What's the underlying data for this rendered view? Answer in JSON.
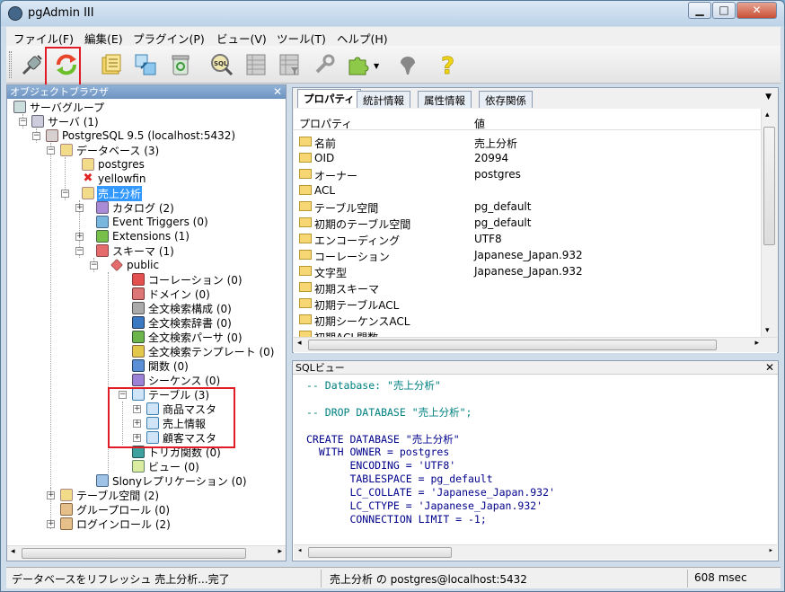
{
  "window": {
    "title": "pgAdmin III",
    "minimize": "▁",
    "maximize": "□",
    "close": "✕"
  },
  "menu": [
    "ファイル(F)",
    "編集(E)",
    "プラグイン(P)",
    "ビュー(V)",
    "ツール(T)",
    "ヘルプ(H)"
  ],
  "toolbar": {
    "buttons": [
      "connect-icon",
      "refresh-icon",
      "properties-icon",
      "create-icon",
      "delete-icon",
      "sql-query-icon",
      "view-data-icon",
      "filtered-view-icon",
      "maintenance-icon",
      "plugins-icon",
      "help-icon",
      "hint-icon"
    ]
  },
  "browser": {
    "title": "オブジェクトブラウザ",
    "close": "✕",
    "nodes": [
      {
        "label": "サーバグループ"
      },
      {
        "label": "サーバ (1)"
      },
      {
        "label": "PostgreSQL 9.5 (localhost:5432)"
      },
      {
        "label": "データベース (3)"
      },
      {
        "label": "postgres"
      },
      {
        "label": "yellowfin"
      },
      {
        "label": "売上分析"
      },
      {
        "label": "カタログ (2)"
      },
      {
        "label": "Event Triggers (0)"
      },
      {
        "label": "Extensions (1)"
      },
      {
        "label": "スキーマ (1)"
      },
      {
        "label": "public"
      },
      {
        "label": "コーレーション (0)"
      },
      {
        "label": "ドメイン (0)"
      },
      {
        "label": "全文検索構成 (0)"
      },
      {
        "label": "全文検索辞書 (0)"
      },
      {
        "label": "全文検索パーサ (0)"
      },
      {
        "label": "全文検索テンプレート (0)"
      },
      {
        "label": "関数 (0)"
      },
      {
        "label": "シーケンス (0)"
      },
      {
        "label": "テーブル (3)"
      },
      {
        "label": "商品マスタ"
      },
      {
        "label": "売上情報"
      },
      {
        "label": "顧客マスタ"
      },
      {
        "label": "トリガ関数 (0)"
      },
      {
        "label": "ビュー (0)"
      },
      {
        "label": "Slonyレプリケーション (0)"
      },
      {
        "label": "テーブル空間 (2)"
      },
      {
        "label": "グループロール (0)"
      },
      {
        "label": "ログインロール (2)"
      }
    ]
  },
  "tabs": [
    "プロパティ",
    "統計情報",
    "属性情報",
    "依存関係"
  ],
  "properties": {
    "header_name": "プロパティ",
    "header_value": "値",
    "rows": [
      {
        "name": "名前",
        "value": "売上分析"
      },
      {
        "name": "OID",
        "value": "20994"
      },
      {
        "name": "オーナー",
        "value": "postgres"
      },
      {
        "name": "ACL",
        "value": ""
      },
      {
        "name": "テーブル空間",
        "value": "pg_default"
      },
      {
        "name": "初期のテーブル空間",
        "value": "pg_default"
      },
      {
        "name": "エンコーディング",
        "value": "UTF8"
      },
      {
        "name": "コーレーション",
        "value": "Japanese_Japan.932"
      },
      {
        "name": "文字型",
        "value": "Japanese_Japan.932"
      },
      {
        "name": "初期スキーマ",
        "value": ""
      },
      {
        "name": "初期テーブルACL",
        "value": ""
      },
      {
        "name": "初期シーケンスACL",
        "value": ""
      },
      {
        "name": "初期ACL関数",
        "value": ""
      }
    ]
  },
  "sql": {
    "title": "SQLビュー",
    "close": "✕",
    "lines": [
      "-- Database: \"売上分析\"",
      "",
      "-- DROP DATABASE \"売上分析\";",
      "",
      "CREATE DATABASE \"売上分析\"",
      "  WITH OWNER = postgres",
      "       ENCODING = 'UTF8'",
      "       TABLESPACE = pg_default",
      "       LC_COLLATE = 'Japanese_Japan.932'",
      "       LC_CTYPE = 'Japanese_Japan.932'",
      "       CONNECTION LIMIT = -1;"
    ]
  },
  "status": {
    "message": "データベースをリフレッシュ 売上分析...完了",
    "connection": "売上分析 の postgres@localhost:5432",
    "time": "608 msec"
  },
  "colors": {
    "highlight": "#e01c24",
    "selection": "#3399ff",
    "accent": "#6d93c1"
  }
}
